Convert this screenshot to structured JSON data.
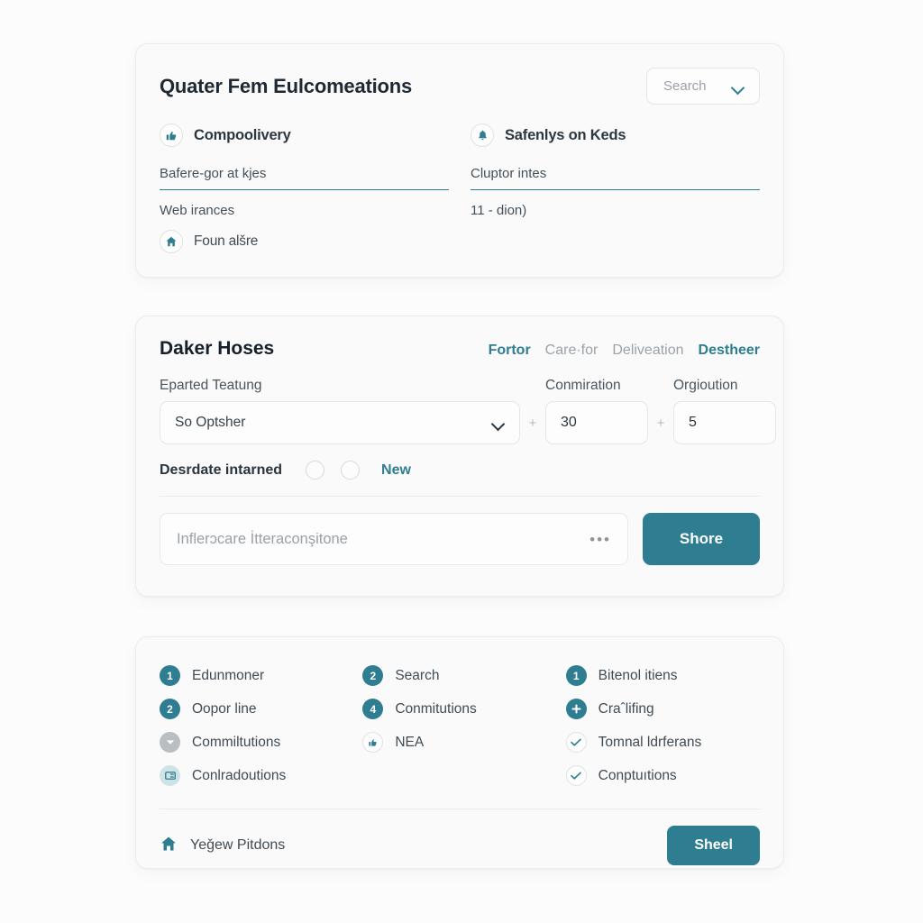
{
  "overview_card": {
    "title": "Quater Fem Eulcomeations",
    "search": {
      "label": "Search",
      "chevron_icon": "chevron-down-icon"
    },
    "left": {
      "heading": {
        "icon": "thumbs-up-icon",
        "label": "Compoolivery"
      },
      "field_value": "Bafere-gor at kjes",
      "sub_text": "Web irances",
      "footer": {
        "icon": "home-icon",
        "label": "Foun alšre"
      }
    },
    "right": {
      "heading": {
        "icon": "bell-icon",
        "label": "Safenlys on Keds"
      },
      "field_value": "Cluptor intes",
      "sub_text": "11 - dion)"
    }
  },
  "form_card": {
    "title": "Daker Hoses",
    "links": [
      {
        "label": "Fortor",
        "active": true
      },
      {
        "label": "Care·for",
        "active": false
      },
      {
        "label": "Deliveation",
        "active": false
      },
      {
        "label": "Destheer",
        "active": true
      }
    ],
    "labels": {
      "main": "Eparted Teatung",
      "num1": "Conmiration",
      "num2": "Orgioution"
    },
    "select": {
      "value": "So Optsher",
      "chevron_icon": "chevron-down-icon"
    },
    "separator": "+",
    "num1_value": "30",
    "num2_value": "5",
    "radio_row": {
      "label": "Desrdate intarned",
      "option_label": "New"
    },
    "action": {
      "input_placeholder": "Inflerɔcare İtteraconşitone",
      "overflow_icon": "ellipsis-icon",
      "button_label": "Shore"
    }
  },
  "list_card": {
    "columns": [
      [
        {
          "badge": "1",
          "badge_style": "teal",
          "icon": "number-badge-icon",
          "label": "Edunmoner"
        },
        {
          "badge": "2",
          "badge_style": "teal",
          "icon": "number-badge-icon",
          "label": "Oopor line"
        },
        {
          "badge": "",
          "badge_style": "gray",
          "icon": "chevron-down-icon",
          "label": "Commiltutions"
        },
        {
          "badge": "",
          "badge_style": "lightteal",
          "icon": "card-icon",
          "label": "Conlradoutions"
        }
      ],
      [
        {
          "badge": "2",
          "badge_style": "teal",
          "icon": "number-badge-icon",
          "label": "Search"
        },
        {
          "badge": "4",
          "badge_style": "teal",
          "icon": "number-badge-icon",
          "label": "Conmitutions"
        },
        {
          "badge": "",
          "badge_style": "outline",
          "icon": "thumbs-up-icon",
          "label": "NEA"
        }
      ],
      [
        {
          "badge": "1",
          "badge_style": "teal",
          "icon": "number-badge-icon",
          "label": "Bitenol itiens"
        },
        {
          "badge": "",
          "badge_style": "teal",
          "icon": "plus-icon",
          "label": "Craˆlifing"
        },
        {
          "badge": "",
          "badge_style": "outline",
          "icon": "check-icon",
          "label": "Tomnal ldrferans"
        },
        {
          "badge": "",
          "badge_style": "outline",
          "icon": "check-icon",
          "label": "Conptuıtions"
        }
      ]
    ],
    "footer": {
      "icon": "home-icon",
      "label": "Yeǧew Pitdons",
      "button_label": "Sheel"
    }
  },
  "colors": {
    "accent": "#2e7d91",
    "page_bg": "#fcfcfc",
    "card_bg": "#fafafa",
    "text": "#2d3740",
    "muted": "#9aa1a8"
  }
}
